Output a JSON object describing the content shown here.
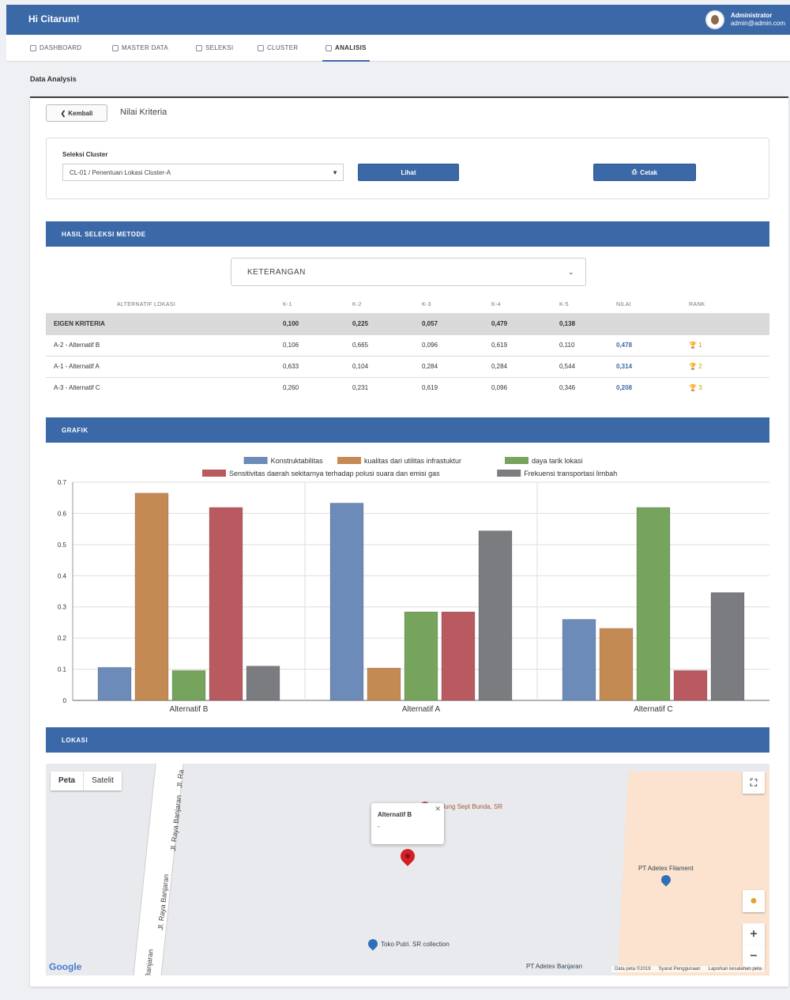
{
  "header": {
    "greeting": "Hi Citarum!",
    "user_name": "Administrator",
    "user_email": "admin@admin.com"
  },
  "nav": {
    "items": [
      {
        "label": "DASHBOARD",
        "icon": "home-icon"
      },
      {
        "label": "MASTER DATA",
        "icon": "database-icon"
      },
      {
        "label": "SELEKSI",
        "icon": "filter-icon"
      },
      {
        "label": "CLUSTER",
        "icon": "cluster-icon"
      },
      {
        "label": "ANALISIS",
        "icon": "document-icon",
        "active": true
      }
    ]
  },
  "page": {
    "subheader": "Data Analysis",
    "back_label": "Kembali",
    "title": "Nilai Kriteria"
  },
  "filter": {
    "label": "Seleksi Cluster",
    "selected": "CL-01 / Penentuan Lokasi Cluster-A",
    "view_button": "Lihat",
    "print_button": "Cetak"
  },
  "sections": {
    "result": "HASIL SELEKSI METODE",
    "chart": "GRAFIK",
    "location": "LOKASI"
  },
  "keterangan": "KETERANGAN",
  "table": {
    "headers": [
      "ALTERNATIF LOKASI",
      "K-1",
      "K-2",
      "K-3",
      "K-4",
      "K-5",
      "NILAI",
      "RANK"
    ],
    "eigen": [
      "EIGEN KRITERIA",
      "0,100",
      "0,225",
      "0,057",
      "0,479",
      "0,138"
    ],
    "rows": [
      [
        "A-2 - Alternatif B",
        "0,106",
        "0,665",
        "0,096",
        "0,619",
        "0,110",
        "0,478",
        "1"
      ],
      [
        "A-1 - Alternatif A",
        "0,633",
        "0,104",
        "0,284",
        "0,284",
        "0,544",
        "0,314",
        "2"
      ],
      [
        "A-3 - Alternatif C",
        "0,260",
        "0,231",
        "0,619",
        "0,096",
        "0,346",
        "0,208",
        "3"
      ]
    ]
  },
  "chart_data": {
    "type": "bar",
    "categories": [
      "Alternatif B",
      "Alternatif A",
      "Alternatif C"
    ],
    "ylim": [
      0,
      0.7
    ],
    "yticks": [
      "0",
      "0.1",
      "0.2",
      "0.3",
      "0.4",
      "0.5",
      "0.6",
      "0.7"
    ],
    "legend_position": "top",
    "series": [
      {
        "name": "Konstruktabilitas",
        "color": "#6d8bb8",
        "values": [
          0.106,
          0.633,
          0.26
        ]
      },
      {
        "name": "kualitas dari utilitas infrastuktur",
        "color": "#c48a54",
        "values": [
          0.665,
          0.104,
          0.231
        ]
      },
      {
        "name": "daya tarik lokasi",
        "color": "#76a45c",
        "values": [
          0.096,
          0.284,
          0.619
        ]
      },
      {
        "name": "Sensitivitas daerah sekitarnya terhadap polusi suara dan emisi gas",
        "color": "#b85a5f",
        "values": [
          0.619,
          0.284,
          0.096
        ]
      },
      {
        "name": "Frekuensi transportasi limbah",
        "color": "#7a7c80",
        "values": [
          0.11,
          0.544,
          0.346
        ]
      }
    ]
  },
  "map": {
    "type_map": "Peta",
    "type_satellite": "Satelit",
    "road1": "Jl. Raya Banjaran",
    "road2": "Jl. Raya Banjaran",
    "road3": "Banjaran",
    "road4": "Jl. Ra",
    "infowindow_title": "Alternatif B",
    "infowindow_body": "-",
    "poi1": "PT Adetex Filament",
    "poi2": "Toko Putri. SR collection",
    "poi3": "Gedung Sept Bunda, SR",
    "poi4": "PT Adetex Banjaran",
    "footer": [
      "Data peta ©2019",
      "Syarat Penggunaan",
      "Laporkan kesalahan peta"
    ],
    "logo": "Google"
  }
}
